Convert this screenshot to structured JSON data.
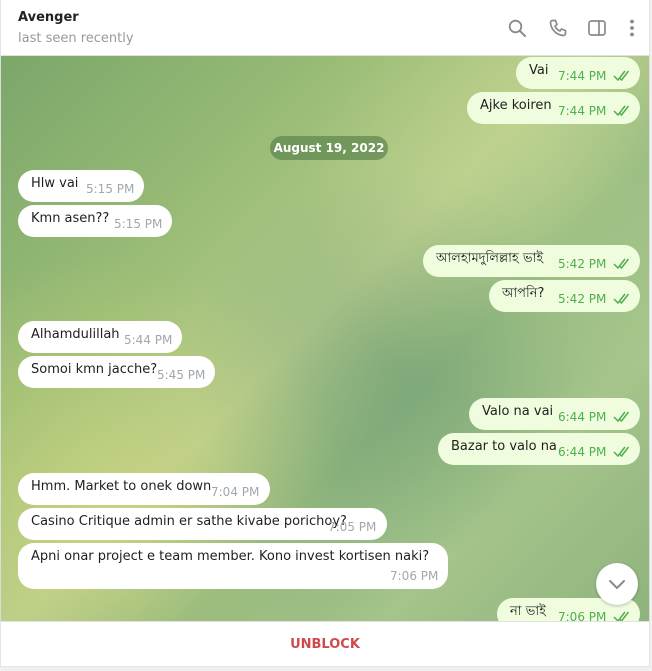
{
  "header": {
    "name": "Avenger",
    "status": "last seen recently",
    "icons": [
      "search-icon",
      "phone-icon",
      "sidebar-toggle-icon",
      "more-vertical-icon"
    ]
  },
  "date_separator": "August 19, 2022",
  "messages": [
    {
      "dir": "out",
      "text": "Vai",
      "time": "7:44 PM"
    },
    {
      "dir": "out",
      "text": "Ajke koiren",
      "time": "7:44 PM"
    },
    {
      "dir": "in",
      "text": "Hlw vai",
      "time": "5:15 PM"
    },
    {
      "dir": "in",
      "text": "Kmn asen??",
      "time": "5:15 PM"
    },
    {
      "dir": "out",
      "text": "আলহামদুলিল্লাহ ভাই",
      "time": "5:42 PM"
    },
    {
      "dir": "out",
      "text": "আপনি?",
      "time": "5:42 PM"
    },
    {
      "dir": "in",
      "text": "Alhamdulillah",
      "time": "5:44 PM"
    },
    {
      "dir": "in",
      "text": "Somoi kmn jacche?",
      "time": "5:45 PM"
    },
    {
      "dir": "out",
      "text": "Valo na vai",
      "time": "6:44 PM"
    },
    {
      "dir": "out",
      "text": "Bazar to valo na",
      "time": "6:44 PM"
    },
    {
      "dir": "in",
      "text": "Hmm. Market to onek down",
      "time": "7:04 PM"
    },
    {
      "dir": "in",
      "text": "Casino Critique admin er sathe kivabe porichoy?",
      "time": "7:05 PM"
    },
    {
      "dir": "in",
      "text": "Apni onar project e team member.  Kono invest kortisen naki?",
      "time": "7:06 PM"
    },
    {
      "dir": "out",
      "text": "না ভাই",
      "time": "7:06 PM"
    }
  ],
  "colors": {
    "incoming_bubble": "#ffffff",
    "outgoing_bubble": "#effdde",
    "outgoing_time": "#4fae4e",
    "unblock_text": "#d0494d"
  },
  "footer": {
    "unblock_label": "UNBLOCK"
  }
}
